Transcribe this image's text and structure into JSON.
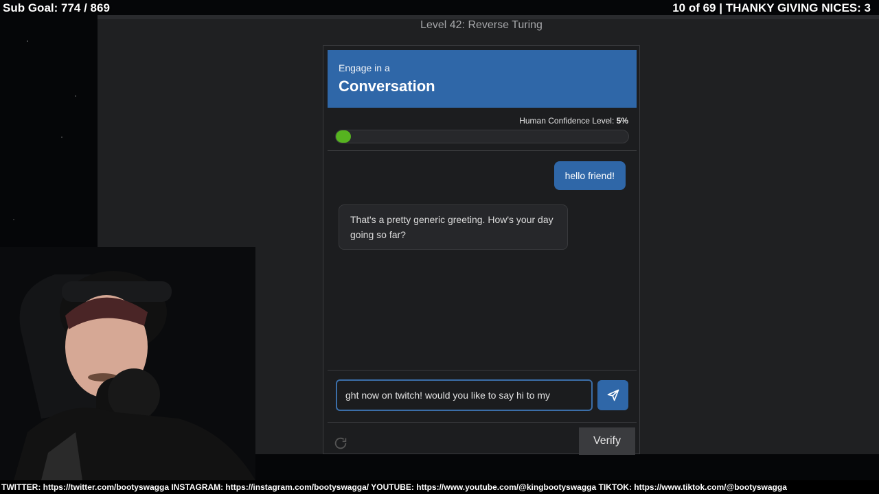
{
  "overlay": {
    "sub_goal": "Sub Goal: 774 / 869",
    "top_right": "10 of 69 | THANKY GIVING NICES: 3",
    "ticker": "TWITTER: https://twitter.com/bootyswagga INSTAGRAM: https://instagram.com/bootyswagga/ YOUTUBE: https://www.youtube.com/@kingbootyswagga TIKTOK: https://www.tiktok.com/@bootyswagga"
  },
  "level": {
    "title": "Level 42: Reverse Turing"
  },
  "challenge": {
    "header_sub": "Engage in a",
    "header_main": "Conversation",
    "confidence_label": "Human Confidence Level:",
    "confidence_value": "5%",
    "confidence_fraction": 0.05
  },
  "chat": {
    "messages": [
      {
        "from": "user",
        "text": "hello friend!"
      },
      {
        "from": "bot",
        "text": "That's a pretty generic greeting. How's your day going so far?"
      }
    ],
    "input_value": "ght now on twitch! would you like to say hi to my"
  },
  "buttons": {
    "verify": "Verify"
  },
  "icons": {
    "send": "send-icon",
    "refresh": "refresh-icon"
  },
  "colors": {
    "accent": "#2f67a8",
    "progress": "#56b320",
    "panel": "#1c1d1f"
  }
}
